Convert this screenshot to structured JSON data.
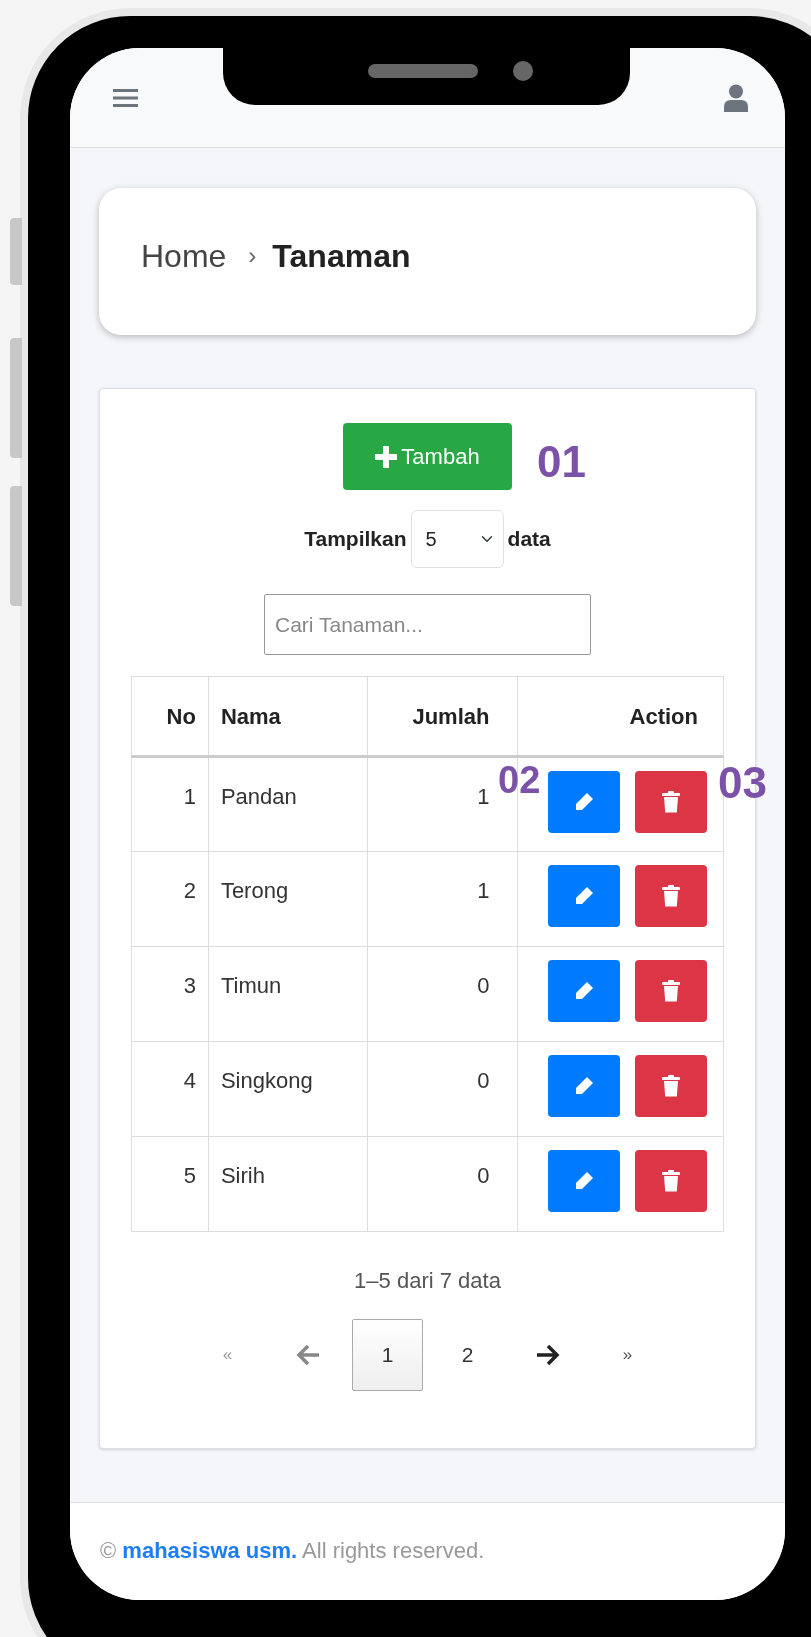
{
  "breadcrumb": {
    "separator": "›",
    "items": [
      {
        "label": "Home",
        "current": false
      },
      {
        "label": "Tanaman",
        "current": true
      }
    ]
  },
  "toolbar": {
    "add_button": "Tambah",
    "show_label": "Tampilkan",
    "page_size": "5",
    "show_suffix": "data",
    "search": {
      "placeholder": "Cari Tanaman..."
    }
  },
  "table": {
    "columns": [
      "No",
      "Nama",
      "Jumlah",
      "Action"
    ],
    "rows": [
      {
        "no": "1",
        "nama": "Pandan",
        "jumlah": "1"
      },
      {
        "no": "2",
        "nama": "Terong",
        "jumlah": "1"
      },
      {
        "no": "3",
        "nama": "Timun",
        "jumlah": "0"
      },
      {
        "no": "4",
        "nama": "Singkong",
        "jumlah": "0"
      },
      {
        "no": "5",
        "nama": "Sirih",
        "jumlah": "0"
      }
    ]
  },
  "summary": "1–5 dari 7 data",
  "pagination": [
    {
      "kind": "first",
      "label": "«",
      "disabled": true
    },
    {
      "kind": "prev",
      "disabled": true
    },
    {
      "kind": "page",
      "label": "1",
      "selected": true
    },
    {
      "kind": "page",
      "label": "2",
      "selected": false
    },
    {
      "kind": "next",
      "disabled": false
    },
    {
      "kind": "last",
      "label": "»",
      "disabled": false
    }
  ],
  "footer": {
    "prefix": "©",
    "link": "mahasiswa usm.",
    "suffix": "All rights reserved."
  },
  "annotations": [
    {
      "label": "01"
    },
    {
      "label": "02"
    },
    {
      "label": "03"
    }
  ]
}
